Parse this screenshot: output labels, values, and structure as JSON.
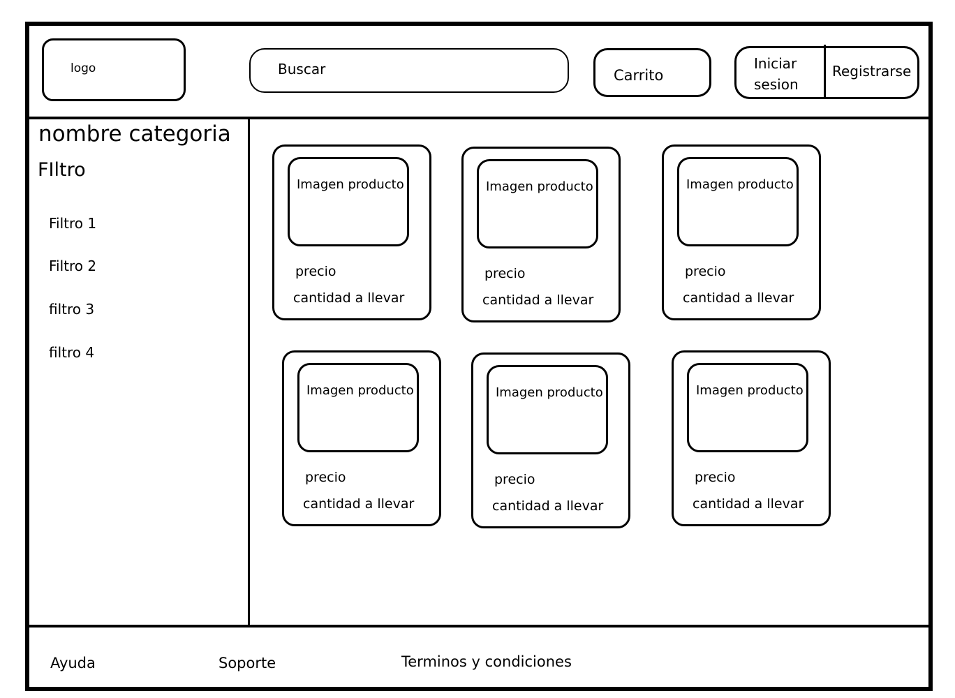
{
  "header": {
    "logo_label": "logo",
    "search_label": "Buscar",
    "cart_label": "Carrito",
    "login_label": "Iniciar sesion",
    "register_label": "Registrarse"
  },
  "sidebar": {
    "category_title": "nombre categoria",
    "filter_title": "FIltro",
    "filters": [
      {
        "label": "Filtro 1"
      },
      {
        "label": "Filtro 2"
      },
      {
        "label": "filtro 3"
      },
      {
        "label": "filtro 4"
      }
    ]
  },
  "products": [
    {
      "image_label": "Imagen producto",
      "price_label": "precio",
      "qty_label": "cantidad a llevar"
    },
    {
      "image_label": "Imagen producto",
      "price_label": "precio",
      "qty_label": "cantidad a llevar"
    },
    {
      "image_label": "Imagen producto",
      "price_label": "precio",
      "qty_label": "cantidad a llevar"
    },
    {
      "image_label": "Imagen producto",
      "price_label": "precio",
      "qty_label": "cantidad a llevar"
    },
    {
      "image_label": "Imagen producto",
      "price_label": "precio",
      "qty_label": "cantidad a llevar"
    },
    {
      "image_label": "Imagen producto",
      "price_label": "precio",
      "qty_label": "cantidad a llevar"
    }
  ],
  "footer": {
    "links": [
      {
        "label": "Ayuda"
      },
      {
        "label": "Soporte"
      },
      {
        "label": "Terminos y condiciones"
      }
    ]
  }
}
